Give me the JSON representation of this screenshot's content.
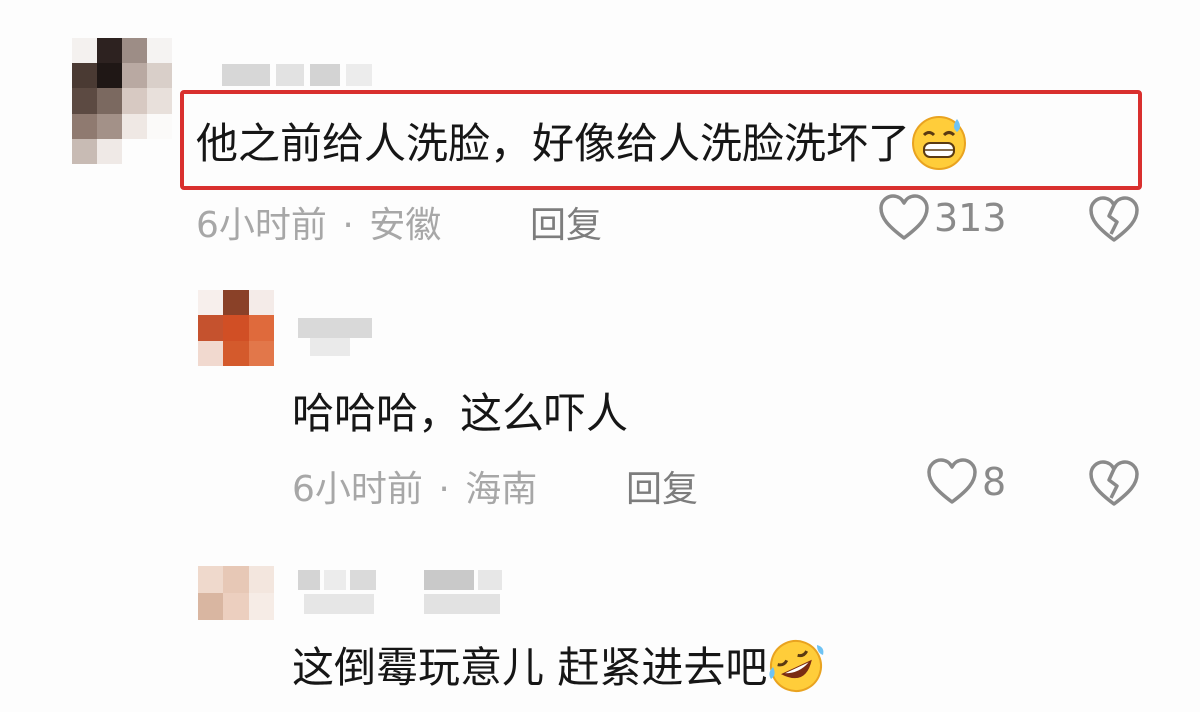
{
  "comments": [
    {
      "text": "他之前给人洗脸，好像给人洗脸洗坏了",
      "emoji": "grin-sweat-emoji",
      "time": "6小时前",
      "separator": "·",
      "location": "安徽",
      "reply_label": "回复",
      "likes": "313",
      "highlighted": true
    },
    {
      "text": "哈哈哈，这么吓人",
      "time": "6小时前",
      "separator": "·",
      "location": "海南",
      "reply_label": "回复",
      "likes": "8"
    },
    {
      "text": "这倒霉玩意儿 赶紧进去吧",
      "emoji": "rolling-laughing-emoji"
    }
  ],
  "colors": {
    "highlight": "#d9302e",
    "meta": "#a7a7a7",
    "text": "#161616"
  }
}
